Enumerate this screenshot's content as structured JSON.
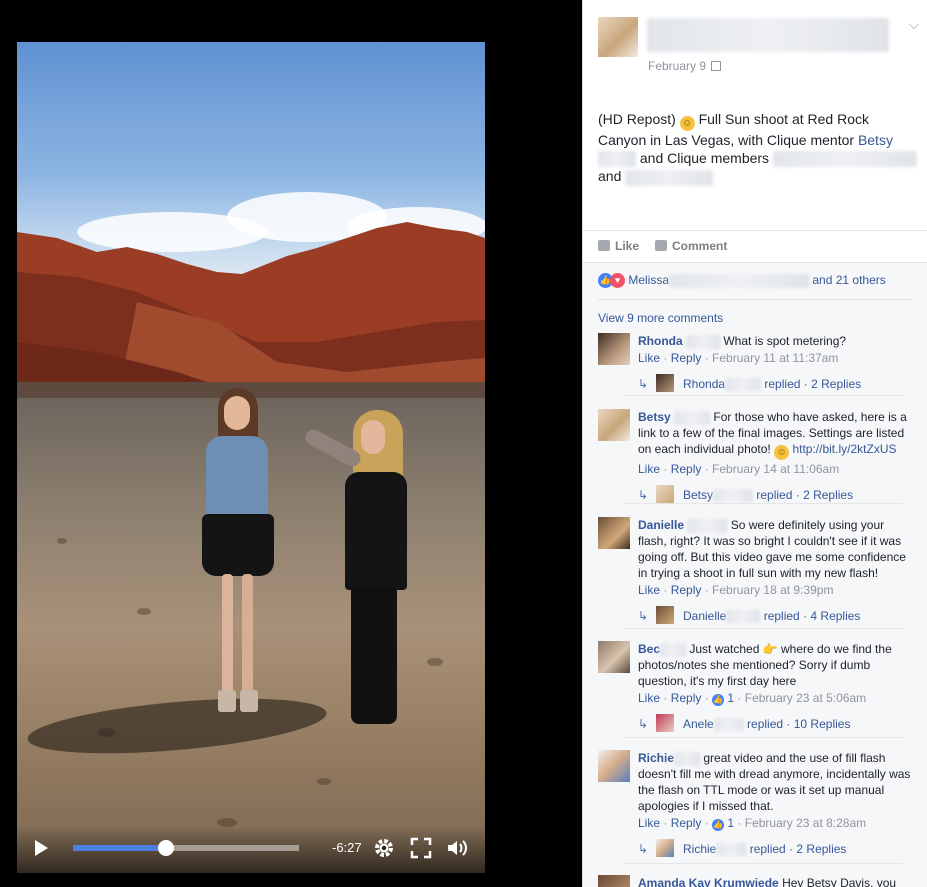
{
  "post": {
    "date": "February 9",
    "text_a": "(HD Repost) ",
    "emoji": "☺",
    "text_b": " Full Sun shoot at Red Rock Canyon in Las Vegas, with Clique mentor ",
    "mentor_link": "Betsy",
    "text_c": " and Clique members ",
    "text_d": " and "
  },
  "actions": {
    "like": "Like",
    "comment": "Comment"
  },
  "reactions": {
    "first_name": "Melissa",
    "others": "and 21 others"
  },
  "view_more": "View 9 more comments",
  "video": {
    "time_remaining": "-6:27",
    "progress": 0.41
  },
  "comments": [
    {
      "name": "Rhonda",
      "text": "What is spot metering?",
      "like": "Like",
      "reply": "Reply",
      "time": "February 11 at 11:37am",
      "likes": "",
      "replier": "Rhonda",
      "replied": "replied",
      "replies": "2 Replies"
    },
    {
      "name": "Betsy",
      "text": "For those who have asked, here is a link to a few of the final images. Settings are listed on each individual photo! ",
      "url": "http://bit.ly/2ktZxUS",
      "like": "Like",
      "reply": "Reply",
      "time": "February 14 at 11:06am",
      "likes": "",
      "replier": "Betsy",
      "replied": "replied",
      "replies": "2 Replies"
    },
    {
      "name": "Danielle",
      "text": "So were definitely using your flash, right? It was so bright I couldn't see if it was going off. But this video gave me some confidence in trying a shoot in full sun with my new flash!",
      "like": "Like",
      "reply": "Reply",
      "time": "February 18 at 9:39pm",
      "likes": "",
      "replier": "Danielle",
      "replied": "replied",
      "replies": "4 Replies"
    },
    {
      "name": "Bec",
      "text": "Just watched 👉 where do we find the photos/notes she mentioned? Sorry if dumb question, it's my first day here",
      "like": "Like",
      "reply": "Reply",
      "time": "February 23 at 5:06am",
      "likes": "1",
      "replier": "Anele",
      "replied": "replied",
      "replies": "10 Replies"
    },
    {
      "name": "Richie",
      "text": "great video and the use of fill flash doesn't fill me with dread anymore, incidentally was the flash on TTL mode or was it set up manual apologies if I missed that.",
      "like": "Like",
      "reply": "Reply",
      "time": "February 23 at 8:28am",
      "likes": "1",
      "replier": "Richie",
      "replied": "replied",
      "replies": "2 Replies"
    },
    {
      "name": "Amanda Kay Krumwiede",
      "text": "Hey Betsy Davis, you"
    }
  ]
}
